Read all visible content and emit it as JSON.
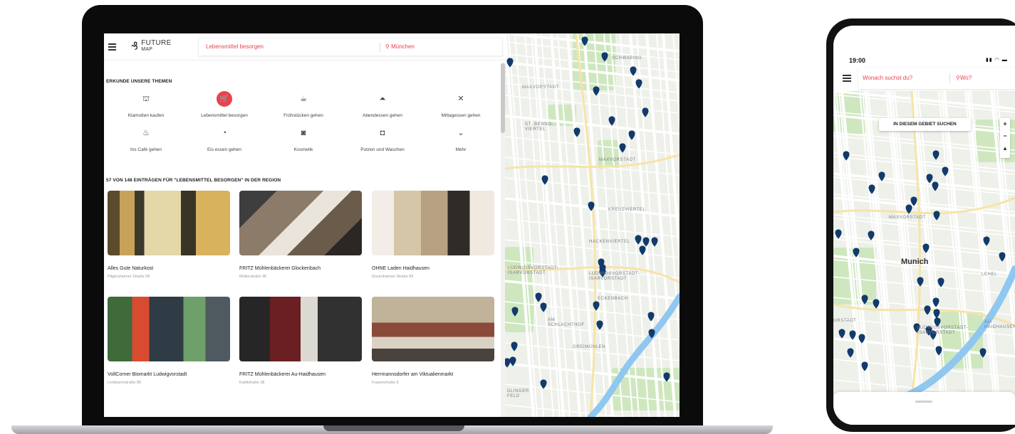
{
  "laptop": {
    "app": {
      "logo": {
        "line1": "FUTURE",
        "line2": "MAP"
      },
      "search": {
        "what": "Lebensmittel besorgen",
        "where": "München",
        "where_icon": "location-pin-icon"
      },
      "topics_heading": "ERKUNDE UNSERE THEMEN",
      "topics": [
        {
          "label": "Klamotten kaufen",
          "icon": "shop-icon",
          "glyph": "⛫",
          "active": false
        },
        {
          "label": "Lebensmittel besorgen",
          "icon": "cart-icon",
          "glyph": "🛒",
          "active": true
        },
        {
          "label": "Frühstücken gehen",
          "icon": "coffee-icon",
          "glyph": "☕",
          "active": false
        },
        {
          "label": "Abendessen gehen",
          "icon": "dinner-icon",
          "glyph": "⏶",
          "active": false
        },
        {
          "label": "Mittagessen gehen",
          "icon": "cutlery-icon",
          "glyph": "✕",
          "active": false
        },
        {
          "label": "Ins Café gehen",
          "icon": "cake-icon",
          "glyph": "♨",
          "active": false
        },
        {
          "label": "Eis essen gehen",
          "icon": "icecream-icon",
          "glyph": "◔",
          "active": false
        },
        {
          "label": "Kosmetik",
          "icon": "cosmetics-icon",
          "glyph": "◙",
          "active": false
        },
        {
          "label": "Putzen und Waschen",
          "icon": "washing-icon",
          "glyph": "◘",
          "active": false
        },
        {
          "label": "Mehr",
          "icon": "chevron-down-icon",
          "glyph": "⌄",
          "active": false
        }
      ],
      "results_heading": "57 VON 148 EINTRÄGEN FÜR \"LEBENSMITTEL BESORGEN\" IN DER REGION",
      "cards": [
        {
          "title": "Alles Gute Naturkost",
          "address": "Pilgersheimer Straße 58"
        },
        {
          "title": "FRITZ Mühlenbäckerei Glockenbach",
          "address": "Müllerstraße 46"
        },
        {
          "title": "OHNE Laden Haidhausen",
          "address": "Rosenheimer Straße 85"
        },
        {
          "title": "VollCorner Biomarkt Ludwigvorstadt",
          "address": "Lindwurmstraße 80"
        },
        {
          "title": "FRITZ Mühlenbäckerei Au-Haidhausen",
          "address": "Kablistraße 38"
        },
        {
          "title": "Herrmannsdorfer am Viktualienmarkt",
          "address": "Frauenstraße 6"
        }
      ],
      "map_labels": [
        "SCHWABING",
        "MAXVORSTADT",
        "ST.-BENNO-VIERTEL",
        "MAXVORSTADT",
        "KREUZVIERTEL",
        "HACKENVIERTEL",
        "LUDWIGSVORSTADT-ISARVORSTADT",
        "LUDWIGSVORSTADT-ISARVORSTADT",
        "ECKENBACH",
        "AM SCHLACHTHOF",
        "GREIMÜHLEN",
        "DLINGER FELD"
      ]
    }
  },
  "phone": {
    "status_time": "19:00",
    "status_icons": "signal-wifi-battery-icons",
    "search": {
      "what": "Wonach suchst du?",
      "where": "Wo?",
      "where_icon": "location-pin-icon"
    },
    "area_button": "IN DIESEM GEBIET SUCHEN",
    "zoom": {
      "in": "+",
      "out": "−",
      "compass": "▴"
    },
    "city_label": "Munich",
    "map_labels": [
      "MAXVORSTADT",
      "LEHEL",
      "LUDWIGSVORSTADT-ISARVORSTADT",
      "AU-HAIDHAUSEN",
      "ORSTADT"
    ]
  },
  "colors": {
    "accent": "#e8434c",
    "marker": "#123a6b",
    "map_bg": "#eef0ea",
    "water": "#8fc7f0",
    "park": "#cfe7bf"
  }
}
